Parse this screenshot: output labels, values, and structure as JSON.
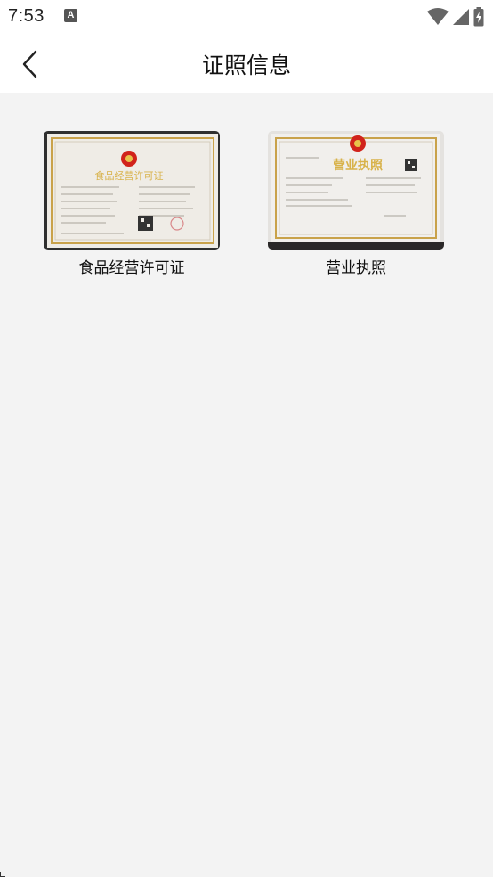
{
  "status_bar": {
    "time": "7:53",
    "notification_icon": "A",
    "icons": [
      "wifi-icon",
      "cell-signal-icon",
      "battery-icon"
    ]
  },
  "header": {
    "title": "证照信息",
    "back_icon": "chevron-left-icon"
  },
  "certificates": [
    {
      "label": "食品经营许可证",
      "doc_title": "食品经营许可证"
    },
    {
      "label": "营业执照",
      "doc_title": "营业执照"
    }
  ],
  "colors": {
    "background": "#f3f3f3",
    "header_bg": "#ffffff",
    "text": "#111111",
    "doc_gold": "#d8b24a",
    "emblem_red": "#d1231b"
  }
}
